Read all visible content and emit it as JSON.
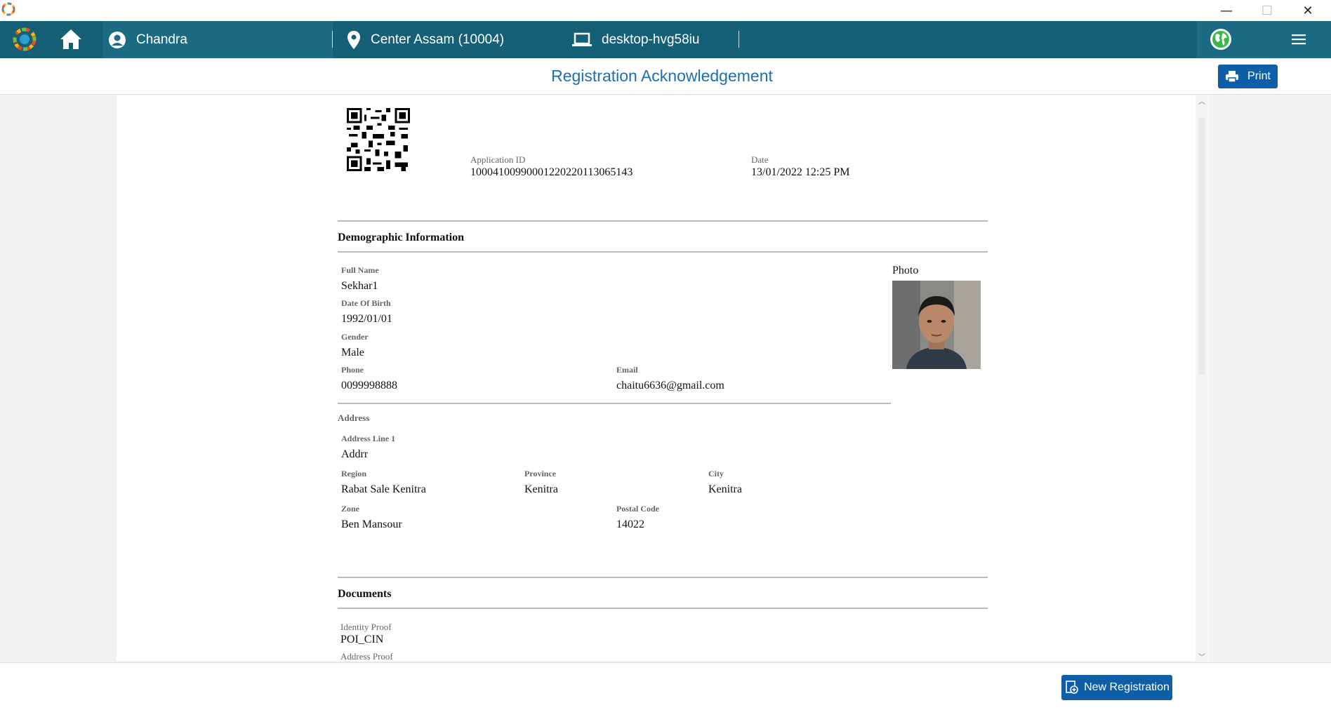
{
  "window": {
    "minimize": "—",
    "maximize": "☐",
    "close": "✕"
  },
  "navbar": {
    "user": "Chandra",
    "center": "Center Assam (10004)",
    "machine": "desktop-hvg58iu"
  },
  "header": {
    "title": "Registration Acknowledgement",
    "print_label": "Print"
  },
  "ack": {
    "application_id_label": "Application ID",
    "application_id": "10004100990001220220113065143",
    "date_label": "Date",
    "date": "13/01/2022 12:25 PM"
  },
  "demographic": {
    "heading": "Demographic Information",
    "full_name_label": "Full Name",
    "full_name": "Sekhar1",
    "dob_label": "Date Of Birth",
    "dob": "1992/01/01",
    "gender_label": "Gender",
    "gender": "Male",
    "phone_label": "Phone",
    "phone": "0099998888",
    "email_label": "Email",
    "email": "chaitu6636@gmail.com",
    "photo_label": "Photo"
  },
  "address": {
    "heading": "Address",
    "line1_label": "Address Line 1",
    "line1": "Addrr",
    "region_label": "Region",
    "region": "Rabat Sale Kenitra",
    "province_label": "Province",
    "province": "Kenitra",
    "city_label": "City",
    "city": "Kenitra",
    "zone_label": "Zone",
    "zone": "Ben Mansour",
    "postal_label": "Postal Code",
    "postal": "14022"
  },
  "documents": {
    "heading": "Documents",
    "identity_label": "Identity Proof",
    "identity": "POI_CIN",
    "address_label": "Address Proof"
  },
  "footer": {
    "new_registration_label": "New Registration"
  },
  "colors": {
    "navbar": "#155f77",
    "accent": "#0f5fa8",
    "title": "#1a6fb5"
  }
}
